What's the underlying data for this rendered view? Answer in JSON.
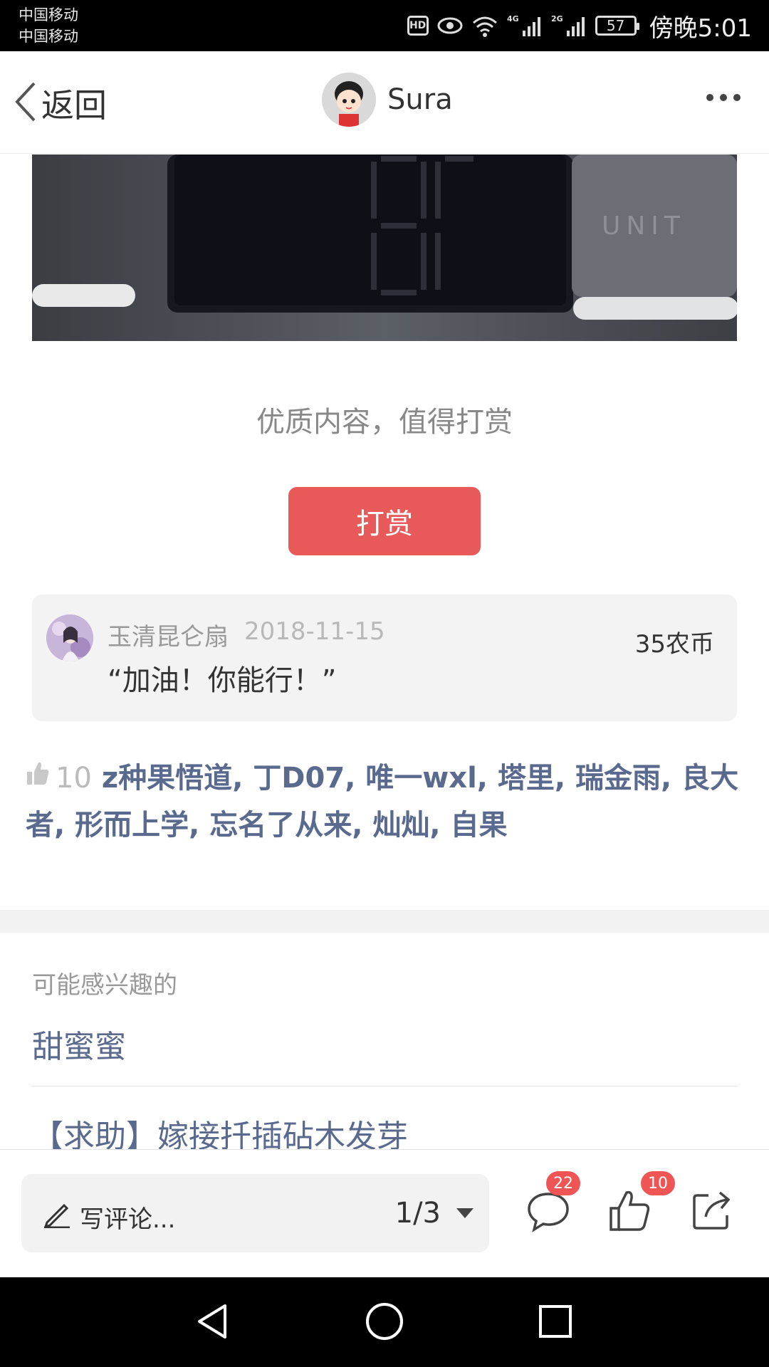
{
  "status_bar": {
    "carrier_1": "中国移动",
    "carrier_2": "中国移动",
    "hd": "HD",
    "network_1": "4G",
    "network_2": "2G",
    "battery": "57",
    "time": "傍晚5:01"
  },
  "nav": {
    "back_label": "返回",
    "user_name": "Sura"
  },
  "photo": {
    "label": "UNIT"
  },
  "reward": {
    "prompt": "优质内容，值得打赏",
    "button": "打赏"
  },
  "tip": {
    "user": "玉清昆仑扇",
    "date": "2018-11-15",
    "amount": "35农币",
    "message": "“加油！你能行！”"
  },
  "likes": {
    "count": "10",
    "names": [
      "z种果悟道",
      "丁D07",
      "唯一wxl",
      "塔里",
      "瑞金雨",
      "良大者",
      "形而上学",
      "忘名了从来",
      "灿灿",
      "自果"
    ]
  },
  "recommend": {
    "label": "可能感兴趣的",
    "items": [
      "甜蜜蜜",
      "【求助】嫁接扦插砧木发芽"
    ]
  },
  "action_bar": {
    "comment_placeholder": "写评论...",
    "page_indicator": "1/3",
    "comment_count": "22",
    "like_count": "10"
  },
  "colors": {
    "accent": "#e85a5a",
    "link": "#5a6a8e",
    "badge": "#ef5555"
  }
}
